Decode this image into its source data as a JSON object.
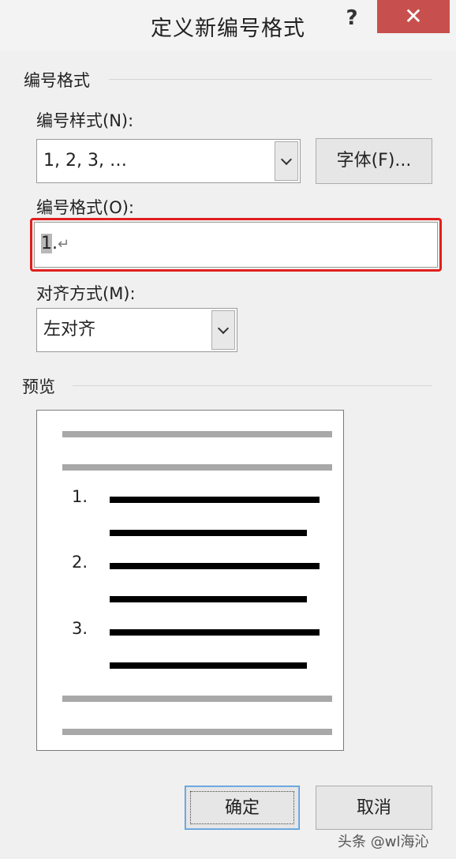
{
  "window": {
    "title": "定义新编号格式",
    "help_label": "?",
    "close_label": "✕"
  },
  "number_format_group": {
    "label": "编号格式"
  },
  "number_style": {
    "label": "编号样式(N):",
    "value": "1, 2, 3, …",
    "font_button": "字体(F)..."
  },
  "number_format": {
    "label": "编号格式(O):",
    "value_selected": "1",
    "value_rest": ".",
    "paragraph_mark": "↵",
    "highlight_color": "#e0201e"
  },
  "alignment": {
    "label": "对齐方式(M):",
    "value": "左对齐"
  },
  "preview": {
    "label": "预览",
    "items": [
      "1.",
      "2.",
      "3."
    ]
  },
  "buttons": {
    "ok": "确定",
    "cancel": "取消"
  },
  "watermark": {
    "text": "头条 @wl海沁"
  }
}
